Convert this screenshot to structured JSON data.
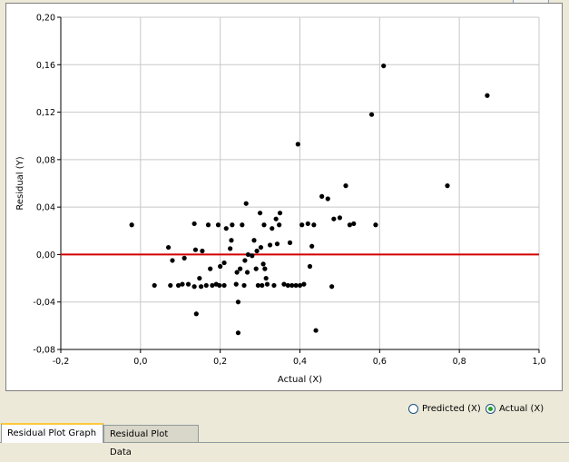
{
  "chart_data": {
    "type": "scatter",
    "xlabel": "Actual (X)",
    "ylabel": "Residual (Y)",
    "xlim": [
      -0.2,
      1.0
    ],
    "ylim": [
      -0.08,
      0.2
    ],
    "x_ticks": [
      "-0,2",
      "0,0",
      "0,2",
      "0,4",
      "0,6",
      "0,8",
      "1,0"
    ],
    "y_ticks": [
      "0,20",
      "0,16",
      "0,12",
      "0,08",
      "0,04",
      "0,00",
      "-0,04",
      "-0,08"
    ],
    "x_tick_values": [
      -0.2,
      0.0,
      0.2,
      0.4,
      0.6,
      0.8,
      1.0
    ],
    "y_tick_values": [
      0.2,
      0.16,
      0.12,
      0.08,
      0.04,
      0.0,
      -0.04,
      -0.08
    ],
    "grid": true,
    "reference_line": {
      "y": 0.0,
      "color": "#d40000"
    },
    "point_color": "#000000",
    "points": [
      [
        -0.022,
        0.025
      ],
      [
        0.035,
        -0.026
      ],
      [
        0.07,
        0.006
      ],
      [
        0.075,
        -0.026
      ],
      [
        0.08,
        -0.005
      ],
      [
        0.095,
        -0.026
      ],
      [
        0.105,
        -0.025
      ],
      [
        0.11,
        -0.003
      ],
      [
        0.12,
        -0.025
      ],
      [
        0.135,
        0.026
      ],
      [
        0.135,
        -0.027
      ],
      [
        0.138,
        0.004
      ],
      [
        0.14,
        -0.05
      ],
      [
        0.148,
        -0.02
      ],
      [
        0.152,
        -0.027
      ],
      [
        0.155,
        0.003
      ],
      [
        0.165,
        -0.026
      ],
      [
        0.17,
        0.025
      ],
      [
        0.175,
        -0.012
      ],
      [
        0.18,
        -0.026
      ],
      [
        0.19,
        -0.025
      ],
      [
        0.195,
        0.025
      ],
      [
        0.198,
        -0.026
      ],
      [
        0.2,
        -0.01
      ],
      [
        0.21,
        -0.026
      ],
      [
        0.21,
        -0.007
      ],
      [
        0.215,
        0.022
      ],
      [
        0.225,
        0.005
      ],
      [
        0.228,
        0.012
      ],
      [
        0.23,
        0.025
      ],
      [
        0.24,
        -0.025
      ],
      [
        0.242,
        -0.015
      ],
      [
        0.245,
        -0.04
      ],
      [
        0.245,
        -0.066
      ],
      [
        0.25,
        -0.012
      ],
      [
        0.255,
        0.025
      ],
      [
        0.26,
        -0.026
      ],
      [
        0.262,
        -0.005
      ],
      [
        0.265,
        0.043
      ],
      [
        0.268,
        -0.015
      ],
      [
        0.27,
        0.0
      ],
      [
        0.28,
        -0.001
      ],
      [
        0.285,
        0.012
      ],
      [
        0.29,
        -0.012
      ],
      [
        0.292,
        0.003
      ],
      [
        0.295,
        -0.026
      ],
      [
        0.3,
        0.035
      ],
      [
        0.302,
        0.006
      ],
      [
        0.305,
        -0.026
      ],
      [
        0.308,
        -0.008
      ],
      [
        0.31,
        0.025
      ],
      [
        0.312,
        -0.012
      ],
      [
        0.315,
        -0.02
      ],
      [
        0.318,
        -0.025
      ],
      [
        0.325,
        0.008
      ],
      [
        0.33,
        0.022
      ],
      [
        0.335,
        -0.026
      ],
      [
        0.34,
        0.03
      ],
      [
        0.343,
        0.009
      ],
      [
        0.348,
        0.025
      ],
      [
        0.35,
        0.035
      ],
      [
        0.36,
        -0.025
      ],
      [
        0.37,
        -0.026
      ],
      [
        0.375,
        0.01
      ],
      [
        0.38,
        -0.026
      ],
      [
        0.39,
        -0.026
      ],
      [
        0.395,
        0.093
      ],
      [
        0.4,
        -0.026
      ],
      [
        0.405,
        0.025
      ],
      [
        0.41,
        -0.025
      ],
      [
        0.42,
        0.026
      ],
      [
        0.425,
        -0.01
      ],
      [
        0.43,
        0.007
      ],
      [
        0.435,
        0.025
      ],
      [
        0.44,
        -0.064
      ],
      [
        0.455,
        0.049
      ],
      [
        0.47,
        0.047
      ],
      [
        0.48,
        -0.027
      ],
      [
        0.485,
        0.03
      ],
      [
        0.5,
        0.031
      ],
      [
        0.515,
        0.058
      ],
      [
        0.525,
        0.025
      ],
      [
        0.535,
        0.026
      ],
      [
        0.58,
        0.118
      ],
      [
        0.59,
        0.025
      ],
      [
        0.61,
        0.159
      ],
      [
        0.77,
        0.058
      ],
      [
        0.87,
        0.134
      ]
    ]
  },
  "options": {
    "predicted_label": "Predicted (X)",
    "actual_label": "Actual (X)",
    "selected": "actual"
  },
  "tabs": [
    {
      "label": "Residual Plot Graph",
      "active": true
    },
    {
      "label": "Residual Plot Data",
      "active": false
    }
  ]
}
